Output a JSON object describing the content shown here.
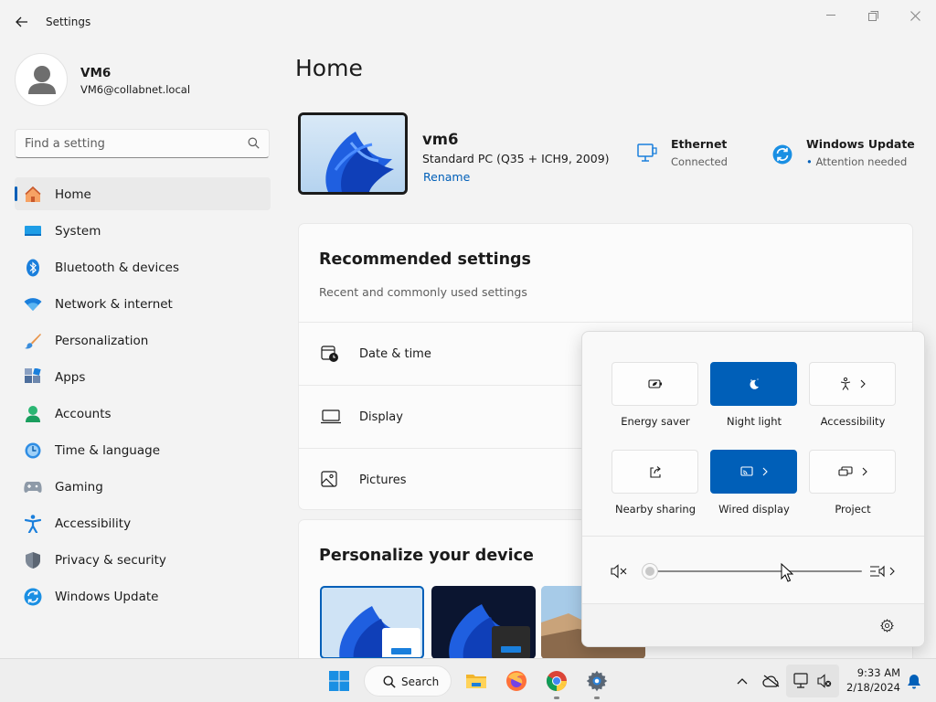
{
  "window": {
    "title": "Settings"
  },
  "user": {
    "name": "VM6",
    "email": "VM6@collabnet.local"
  },
  "search": {
    "placeholder": "Find a setting"
  },
  "nav": [
    {
      "label": "Home",
      "icon": "home-icon"
    },
    {
      "label": "System",
      "icon": "system-icon"
    },
    {
      "label": "Bluetooth & devices",
      "icon": "bluetooth-icon"
    },
    {
      "label": "Network & internet",
      "icon": "wifi-icon"
    },
    {
      "label": "Personalization",
      "icon": "brush-icon"
    },
    {
      "label": "Apps",
      "icon": "apps-icon"
    },
    {
      "label": "Accounts",
      "icon": "accounts-icon"
    },
    {
      "label": "Time & language",
      "icon": "time-language-icon"
    },
    {
      "label": "Gaming",
      "icon": "gamepad-icon"
    },
    {
      "label": "Accessibility",
      "icon": "accessibility-icon"
    },
    {
      "label": "Privacy & security",
      "icon": "shield-icon"
    },
    {
      "label": "Windows Update",
      "icon": "windows-update-icon"
    }
  ],
  "main": {
    "title": "Home",
    "device": {
      "name": "vm6",
      "model": "Standard PC (Q35 + ICH9, 2009)",
      "rename": "Rename"
    },
    "ethernet": {
      "title": "Ethernet",
      "status": "Connected"
    },
    "update": {
      "title": "Windows Update",
      "status": "Attention needed"
    },
    "recommended": {
      "title": "Recommended settings",
      "subtitle": "Recent and commonly used settings",
      "items": [
        {
          "label": "Date & time",
          "icon": "calendar-clock-icon"
        },
        {
          "label": "Display",
          "icon": "display-icon"
        },
        {
          "label": "Pictures",
          "icon": "picture-icon"
        }
      ]
    },
    "personalize": {
      "title": "Personalize your device"
    }
  },
  "quick_settings": {
    "tiles": [
      {
        "label": "Energy saver",
        "icon": "battery-leaf-icon",
        "active": false,
        "expand": false
      },
      {
        "label": "Night light",
        "icon": "night-light-icon",
        "active": true,
        "expand": false
      },
      {
        "label": "Accessibility",
        "icon": "accessibility-icon",
        "active": false,
        "expand": true
      },
      {
        "label": "Nearby sharing",
        "icon": "share-icon",
        "active": false,
        "expand": false
      },
      {
        "label": "Wired display",
        "icon": "cast-icon",
        "active": true,
        "expand": true
      },
      {
        "label": "Project",
        "icon": "project-icon",
        "active": false,
        "expand": true
      }
    ],
    "volume": {
      "level": 0,
      "muted": true
    }
  },
  "taskbar": {
    "search_label": "Search",
    "time": "9:33 AM",
    "date": "2/18/2024"
  },
  "colors": {
    "accent": "#005fb8"
  }
}
